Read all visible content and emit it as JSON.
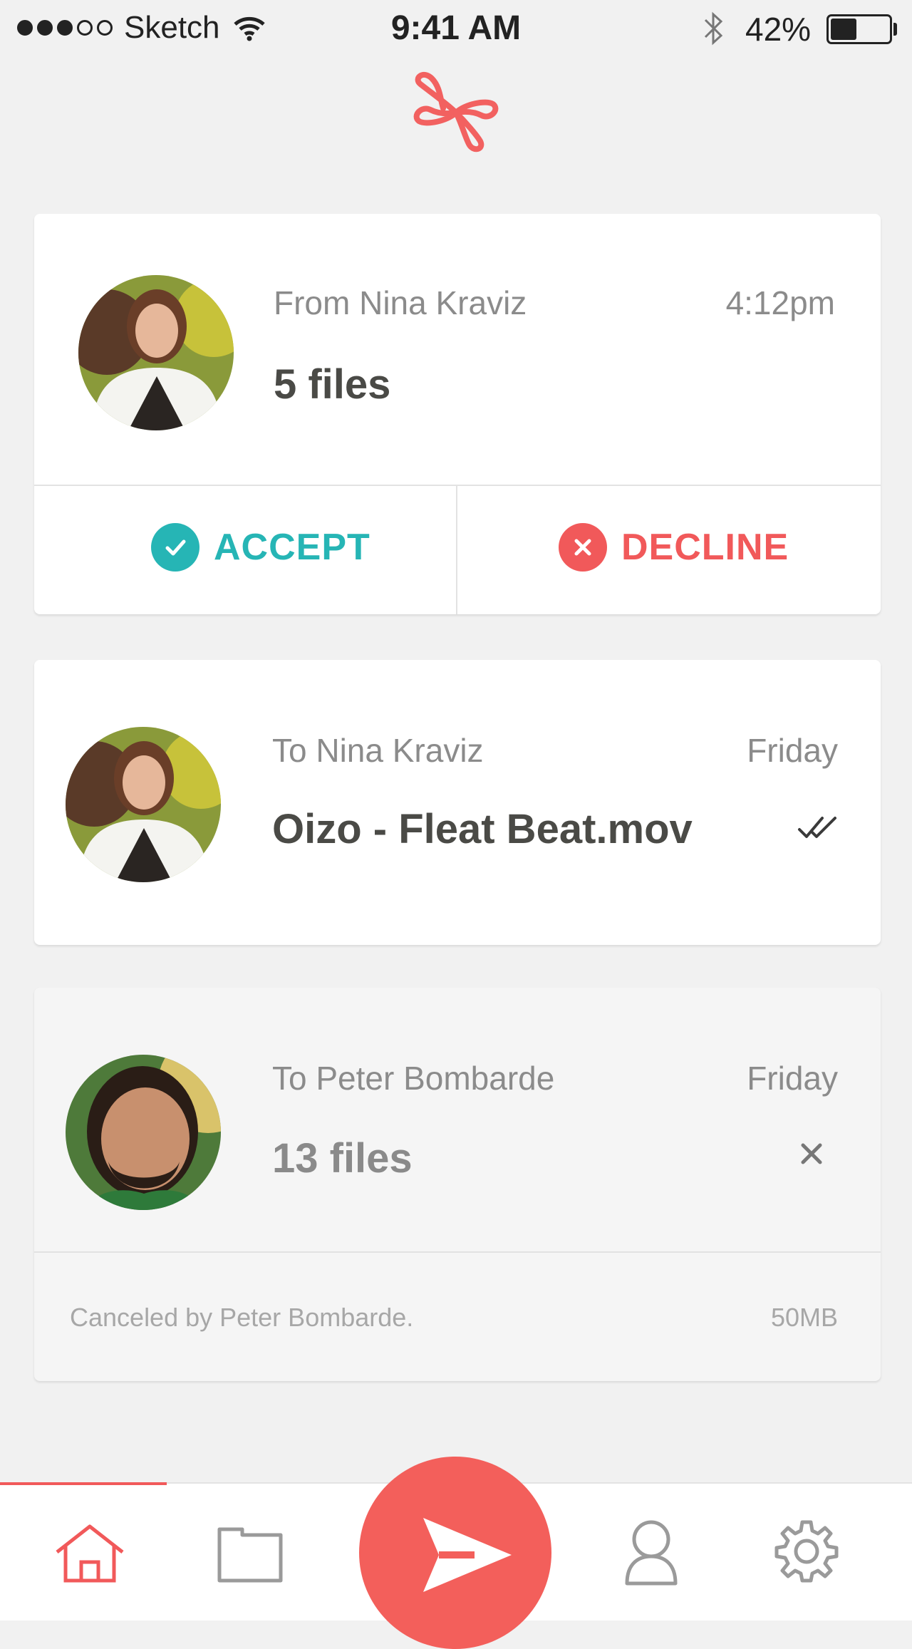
{
  "status_bar": {
    "carrier": "Sketch",
    "time": "9:41 AM",
    "battery": "42%",
    "battery_level": 0.42
  },
  "logo_icon": "cloverleaf-logo-icon",
  "colors": {
    "accent": "#f35f5b",
    "accept": "#26b5b5",
    "decline": "#f1595a",
    "background": "#f1f1f1"
  },
  "transfers": [
    {
      "direction_label": "From Nina Kraviz",
      "time": "4:12pm",
      "title": "5 files",
      "actions": {
        "accept": "ACCEPT",
        "decline": "DECLINE"
      }
    },
    {
      "direction_label": "To Nina Kraviz",
      "time": "Friday",
      "title": "Oizo - Fleat Beat.mov",
      "status_icon": "double-check-icon"
    },
    {
      "direction_label": "To Peter Bombarde",
      "time": "Friday",
      "title": "13 files",
      "status_icon": "close-icon",
      "note": "Canceled by Peter Bombarde.",
      "size": "50MB"
    }
  ],
  "tabbar": {
    "items": [
      "home-icon",
      "folder-icon",
      "send-icon",
      "profile-icon",
      "settings-icon"
    ],
    "active": "home-icon"
  }
}
